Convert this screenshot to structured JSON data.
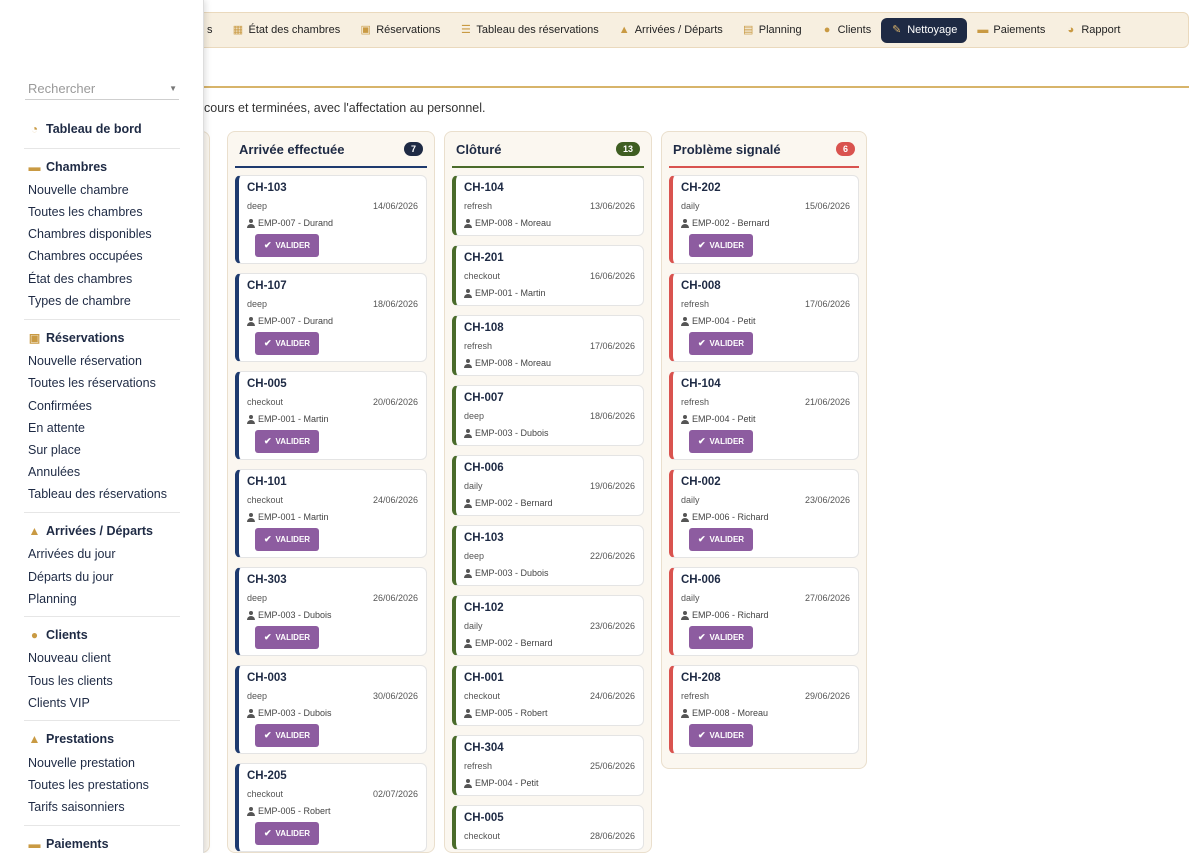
{
  "topnav": {
    "items": [
      {
        "label": "s",
        "icon": "dashboard-icon"
      },
      {
        "label": "État des chambres",
        "icon": "grid-icon"
      },
      {
        "label": "Réservations",
        "icon": "calendar-check-icon"
      },
      {
        "label": "Tableau des réservations",
        "icon": "list-icon"
      },
      {
        "label": "Arrivées / Départs",
        "icon": "plane-icon"
      },
      {
        "label": "Planning",
        "icon": "calendar-icon"
      },
      {
        "label": "Clients",
        "icon": "user-icon"
      },
      {
        "label": "Nettoyage",
        "icon": "broom-icon",
        "active": true
      },
      {
        "label": "Paiements",
        "icon": "money-icon"
      },
      {
        "label": "Rapport",
        "icon": "chart-pie-icon"
      }
    ]
  },
  "page": {
    "subtitle": "cours et terminées, avec l'affectation au personnel."
  },
  "board": {
    "valider_label": "VALIDER",
    "columns": [
      {
        "title": "Arrivée effectuée",
        "count": "7",
        "color": "#1e3a6e",
        "badge_color": "#1e2a44",
        "cards": [
          {
            "room": "CH-103",
            "type": "deep",
            "date": "14/06/2026",
            "emp": "EMP-007 - Durand"
          },
          {
            "room": "CH-107",
            "type": "deep",
            "date": "18/06/2026",
            "emp": "EMP-007 - Durand"
          },
          {
            "room": "CH-005",
            "type": "checkout",
            "date": "20/06/2026",
            "emp": "EMP-001 - Martin"
          },
          {
            "room": "CH-101",
            "type": "checkout",
            "date": "24/06/2026",
            "emp": "EMP-001 - Martin"
          },
          {
            "room": "CH-303",
            "type": "deep",
            "date": "26/06/2026",
            "emp": "EMP-003 - Dubois"
          },
          {
            "room": "CH-003",
            "type": "deep",
            "date": "30/06/2026",
            "emp": "EMP-003 - Dubois"
          },
          {
            "room": "CH-205",
            "type": "checkout",
            "date": "02/07/2026",
            "emp": "EMP-005 - Robert"
          }
        ]
      },
      {
        "title": "Clôturé",
        "count": "13",
        "color": "#4a6b2a",
        "badge_color": "#3f5e22",
        "cards": [
          {
            "room": "CH-104",
            "type": "refresh",
            "date": "13/06/2026",
            "emp": "EMP-008 - Moreau"
          },
          {
            "room": "CH-201",
            "type": "checkout",
            "date": "16/06/2026",
            "emp": "EMP-001 - Martin"
          },
          {
            "room": "CH-108",
            "type": "refresh",
            "date": "17/06/2026",
            "emp": "EMP-008 - Moreau"
          },
          {
            "room": "CH-007",
            "type": "deep",
            "date": "18/06/2026",
            "emp": "EMP-003 - Dubois"
          },
          {
            "room": "CH-006",
            "type": "daily",
            "date": "19/06/2026",
            "emp": "EMP-002 - Bernard"
          },
          {
            "room": "CH-103",
            "type": "deep",
            "date": "22/06/2026",
            "emp": "EMP-003 - Dubois"
          },
          {
            "room": "CH-102",
            "type": "daily",
            "date": "23/06/2026",
            "emp": "EMP-002 - Bernard"
          },
          {
            "room": "CH-001",
            "type": "checkout",
            "date": "24/06/2026",
            "emp": "EMP-005 - Robert"
          },
          {
            "room": "CH-304",
            "type": "refresh",
            "date": "25/06/2026",
            "emp": "EMP-004 - Petit"
          },
          {
            "room": "CH-005",
            "type": "checkout",
            "date": "28/06/2026",
            "emp": ""
          }
        ]
      },
      {
        "title": "Problème signalé",
        "count": "6",
        "color": "#d9534f",
        "badge_color": "#d9534f",
        "cards": [
          {
            "room": "CH-202",
            "type": "daily",
            "date": "15/06/2026",
            "emp": "EMP-002 - Bernard"
          },
          {
            "room": "CH-008",
            "type": "refresh",
            "date": "17/06/2026",
            "emp": "EMP-004 - Petit"
          },
          {
            "room": "CH-104",
            "type": "refresh",
            "date": "21/06/2026",
            "emp": "EMP-004 - Petit"
          },
          {
            "room": "CH-002",
            "type": "daily",
            "date": "23/06/2026",
            "emp": "EMP-006 - Richard"
          },
          {
            "room": "CH-006",
            "type": "daily",
            "date": "27/06/2026",
            "emp": "EMP-006 - Richard"
          },
          {
            "room": "CH-208",
            "type": "refresh",
            "date": "29/06/2026",
            "emp": "EMP-008 - Moreau"
          }
        ]
      }
    ]
  },
  "sidebar": {
    "search_placeholder": "Rechercher",
    "dashboard": "Tableau de bord",
    "sections": [
      {
        "title": "Chambres",
        "icon": "bed-icon",
        "items": [
          "Nouvelle chambre",
          "Toutes les chambres",
          "Chambres disponibles",
          "Chambres occupées",
          "État des chambres",
          "Types de chambre"
        ]
      },
      {
        "title": "Réservations",
        "icon": "calendar-check-icon",
        "items": [
          "Nouvelle réservation",
          "Toutes les réservations",
          "Confirmées",
          "En attente",
          "Sur place",
          "Annulées",
          "Tableau des réservations"
        ]
      },
      {
        "title": "Arrivées / Départs",
        "icon": "plane-icon",
        "items": [
          "Arrivées du jour",
          "Départs du jour",
          "Planning"
        ]
      },
      {
        "title": "Clients",
        "icon": "user-icon",
        "items": [
          "Nouveau client",
          "Tous les clients",
          "Clients VIP"
        ]
      },
      {
        "title": "Prestations",
        "icon": "plane-icon",
        "items": [
          "Nouvelle prestation",
          "Toutes les prestations",
          "Tarifs saisonniers"
        ]
      },
      {
        "title": "Paiements",
        "icon": "money-icon",
        "items": []
      }
    ]
  }
}
